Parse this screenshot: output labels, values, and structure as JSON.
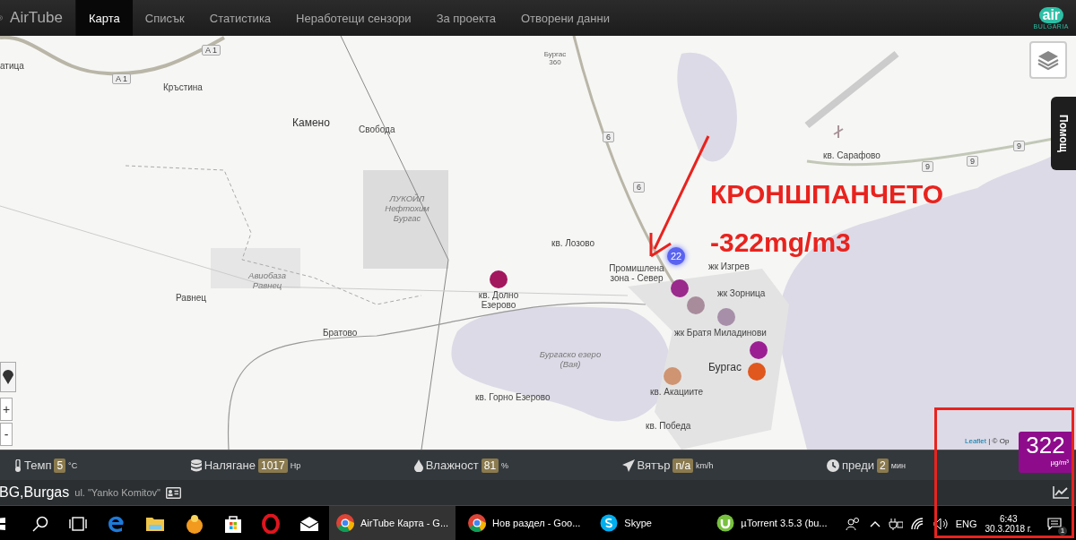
{
  "navbar": {
    "brand": "AirTube",
    "tabs": [
      {
        "label": "Карта",
        "selected": true
      },
      {
        "label": "Списък",
        "selected": false
      },
      {
        "label": "Статистика",
        "selected": false
      },
      {
        "label": "Неработещи сензори",
        "selected": false
      },
      {
        "label": "За проекта",
        "selected": false
      },
      {
        "label": "Отворени данни",
        "selected": false
      }
    ],
    "logo": {
      "word": "air",
      "country": "BULGARIA"
    }
  },
  "map": {
    "labels": [
      {
        "text": "атица",
        "kind": "place"
      },
      {
        "text": "Кръстина",
        "kind": "place"
      },
      {
        "text": "Камено",
        "kind": "town"
      },
      {
        "text": "Свобода",
        "kind": "place"
      },
      {
        "text": "ЛУКОЙЛ Нефтохим Бургас",
        "kind": "area"
      },
      {
        "text": "Авиобаза Равнец",
        "kind": "area"
      },
      {
        "text": "Равнец",
        "kind": "place"
      },
      {
        "text": "Братово",
        "kind": "place"
      },
      {
        "text": "кв. Лозово",
        "kind": "place"
      },
      {
        "text": "Промишлена зона - Север",
        "kind": "place"
      },
      {
        "text": "кв. Долно Езерово",
        "kind": "place"
      },
      {
        "text": "жк Изгрев",
        "kind": "place"
      },
      {
        "text": "жк Зорница",
        "kind": "place"
      },
      {
        "text": "жк Братя Миладинови",
        "kind": "place"
      },
      {
        "text": "Бургаско езеро (Вая)",
        "kind": "area"
      },
      {
        "text": "кв. Горно Езерово",
        "kind": "place"
      },
      {
        "text": "Бургас",
        "kind": "town"
      },
      {
        "text": "кв. Акациите",
        "kind": "place"
      },
      {
        "text": "кв. Победа",
        "kind": "place"
      },
      {
        "text": "кв. Сарафово",
        "kind": "place"
      },
      {
        "text": "Бургас 360",
        "kind": "small"
      }
    ],
    "road_shields": [
      "A 1",
      "A 1",
      "6",
      "6",
      "9",
      "9",
      "9"
    ],
    "sensors": [
      {
        "color": "#a3175f"
      },
      {
        "color": "#5a63f0",
        "label": "22"
      },
      {
        "color": "#9a2a8c"
      },
      {
        "color": "#a88c9c"
      },
      {
        "color": "#a78fa9"
      },
      {
        "color": "#9b1f92"
      },
      {
        "color": "#e0581e"
      },
      {
        "color": "#cf9472"
      }
    ],
    "help_tab": "Помощ",
    "zoom_in": "+",
    "zoom_out": "-",
    "attribution": {
      "link": "Leaflet",
      "rest": "| © Op"
    }
  },
  "annotation": {
    "title": "КРОНШПАНЧЕТО",
    "subtitle": "-322mg/m3"
  },
  "reading": {
    "value": "322",
    "unit": "µg/m³",
    "color": "#8e0c8c"
  },
  "stats": [
    {
      "kind": "temp",
      "label": "Темп",
      "value": "5",
      "unit": "°C"
    },
    {
      "kind": "pressure",
      "label": "Налягане",
      "value": "1017",
      "unit": "Hp"
    },
    {
      "kind": "humidity",
      "label": "Влажност",
      "value": "81",
      "unit": "%"
    },
    {
      "kind": "wind",
      "label": "Вятър",
      "value": "n/a",
      "unit": "km/h"
    },
    {
      "kind": "time",
      "label": "преди",
      "value": "2",
      "unit": "мин"
    }
  ],
  "location": {
    "city": "BG,Burgas",
    "street": "ul. \"Yanko Komitov\""
  },
  "taskbar": {
    "windows": [
      {
        "kind": "chrome",
        "label": "AirTube Карта - G...",
        "selected": true
      },
      {
        "kind": "chrome",
        "label": "Нов раздел - Goo...",
        "selected": false
      },
      {
        "kind": "skype",
        "label": "Skype",
        "selected": false
      },
      {
        "kind": "utorrent",
        "label": "µTorrent 3.5.3  (bu...",
        "selected": false
      }
    ],
    "language": "ENG",
    "time": "6:43",
    "date": "30.3.2018 г.",
    "notifications": "1"
  }
}
